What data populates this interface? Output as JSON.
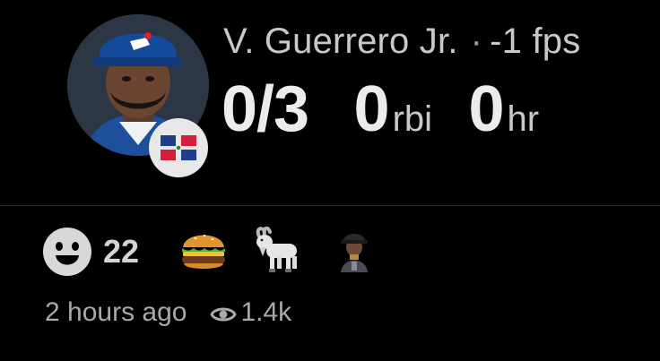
{
  "player": {
    "name": "V. Guerrero Jr.",
    "separator": "·",
    "fps": "-1 fps",
    "flag": "dominican-republic-flag"
  },
  "stats": {
    "at_bats": "0/3",
    "rbi_value": "0",
    "rbi_label": "rbi",
    "hr_value": "0",
    "hr_label": "hr"
  },
  "reactions": {
    "smiley_icon": "smiley-face-icon",
    "count": "22",
    "emojis": [
      "burger-emoji",
      "goat-emoji",
      "custom-gif-reaction"
    ]
  },
  "meta": {
    "time_ago": "2 hours ago",
    "views": "1.4k",
    "views_icon": "eye-icon"
  },
  "colors": {
    "background": "#000000",
    "text_primary": "#ececec",
    "text_secondary": "#a9a9a9",
    "divider": "#2e2e2e"
  }
}
